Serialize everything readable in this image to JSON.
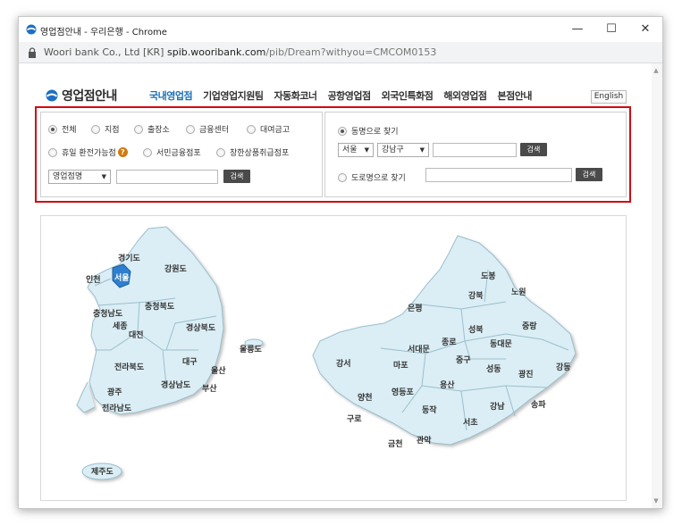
{
  "window": {
    "title": "영업점안내 - 우리은행 - Chrome",
    "minimize": "—",
    "maximize": "☐",
    "close": "✕"
  },
  "address": {
    "site": "Woori bank Co., Ltd [KR]",
    "url_host": "spib.wooribank.com",
    "url_path": "/pib/Dream?withyou=CMCOM0153"
  },
  "header": {
    "logo": "영업점안내",
    "nav": [
      "국내영업점",
      "기업영업지원팀",
      "자동화코너",
      "공항영업점",
      "외국인특화점",
      "해외영업점",
      "본점안내"
    ],
    "english": "English"
  },
  "filters": {
    "types": [
      {
        "label": "전체",
        "checked": true
      },
      {
        "label": "지점",
        "checked": false
      },
      {
        "label": "출장소",
        "checked": false
      },
      {
        "label": "금융센터",
        "checked": false
      },
      {
        "label": "대여금고",
        "checked": false
      }
    ],
    "types2": [
      {
        "label": "휴일 환전가능점",
        "checked": false
      },
      {
        "label": "서민금융점포",
        "checked": false
      },
      {
        "label": "창한상품취급점포",
        "checked": false
      }
    ],
    "branch_select": "영업점명",
    "search_button": "검색"
  },
  "region_search": {
    "by_dong_label": "동명으로 찾기",
    "city": "서울",
    "district": "강남구",
    "search_button": "검색",
    "by_road_label": "도로명으로 찾기",
    "road_search_button": "검색"
  },
  "korea_map": {
    "regions": [
      "경기도",
      "인천",
      "서울",
      "강원도",
      "충청북도",
      "충청남도",
      "세종",
      "대전",
      "경상북도",
      "울릉도",
      "전라북도",
      "대구",
      "울산",
      "광주",
      "경상남도",
      "부산",
      "전라남도",
      "제주도"
    ],
    "highlight": "서울",
    "highlight_color": "#2f7fd0"
  },
  "seoul_map": {
    "districts": [
      "도봉",
      "강북",
      "노원",
      "은평",
      "성북",
      "중랑",
      "종로",
      "동대문",
      "서대문",
      "강서",
      "마포",
      "중구",
      "성동",
      "광진",
      "강동",
      "용산",
      "영등포",
      "양천",
      "동작",
      "강남",
      "송파",
      "구로",
      "서초",
      "금천",
      "관악"
    ]
  },
  "colors": {
    "accent": "#1a6fb8",
    "frame": "#d20a11",
    "map_fill": "#dbeef5"
  }
}
